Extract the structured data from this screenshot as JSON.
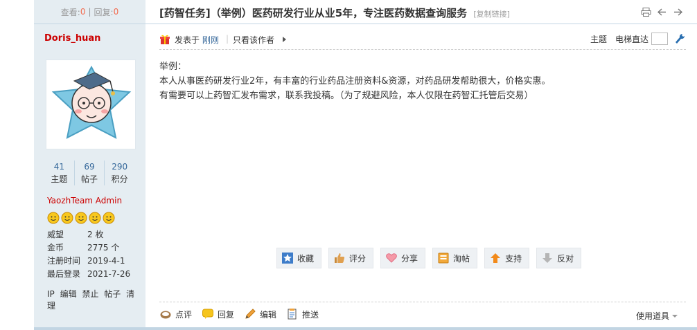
{
  "sidebar": {
    "views_label": "查看:",
    "views": "0",
    "replies_label": "回复:",
    "replies": "0",
    "username": "Doris_huan",
    "stats": [
      {
        "value": "41",
        "label": "主题"
      },
      {
        "value": "69",
        "label": "帖子"
      },
      {
        "value": "290",
        "label": "积分"
      }
    ],
    "group": "YaozhTeam Admin",
    "medal_count": 5,
    "info": [
      {
        "key": "威望",
        "value": "2 枚"
      },
      {
        "key": "金币",
        "value": "2775 个"
      },
      {
        "key": "注册时间",
        "value": "2019-4-1"
      },
      {
        "key": "最后登录",
        "value": "2021-7-26"
      }
    ],
    "tools": [
      "IP",
      "编辑",
      "禁止",
      "帖子",
      "清理"
    ]
  },
  "header": {
    "title": "[药智任务]（举例）医药研发行业从业5年，专注医药数据查询服务",
    "copy_link": "[复制链接]",
    "icons": [
      "print-icon",
      "prev-thread-icon",
      "next-thread-icon"
    ]
  },
  "author_line": {
    "posted_prefix": "发表于",
    "posted_time": "刚刚",
    "separator": "|",
    "only_author": "只看该作者",
    "topic": "主题",
    "jump": "电梯直达"
  },
  "content": {
    "lines": [
      "举例：",
      "本人从事医药研发行业2年，有丰富的行业药品注册资料&资源，对药品研发帮助很大，价格实惠。",
      "有需要可以上药智汇发布需求，联系我投稿。（为了规避风险，本人仅限在药智汇托管后交易）"
    ]
  },
  "actions": [
    {
      "label": "收藏",
      "icon": "star-icon"
    },
    {
      "label": "评分",
      "icon": "thumb-icon"
    },
    {
      "label": "分享",
      "icon": "heart-icon"
    },
    {
      "label": "淘帖",
      "icon": "tray-icon"
    },
    {
      "label": "支持",
      "icon": "up-arrow-icon"
    },
    {
      "label": "反对",
      "icon": "down-arrow-icon"
    }
  ],
  "bottom": {
    "items": [
      {
        "label": "点评",
        "icon": "comment-icon"
      },
      {
        "label": "回复",
        "icon": "reply-icon"
      },
      {
        "label": "编辑",
        "icon": "pencil-icon"
      },
      {
        "label": "推送",
        "icon": "push-icon"
      }
    ],
    "use_tools": "使用道具"
  },
  "colors": {
    "sidebar_bg": "#e5edf2",
    "border": "#c2d5e3",
    "username": "#cc0000",
    "link": "#336699",
    "count": "#f26c4f"
  }
}
